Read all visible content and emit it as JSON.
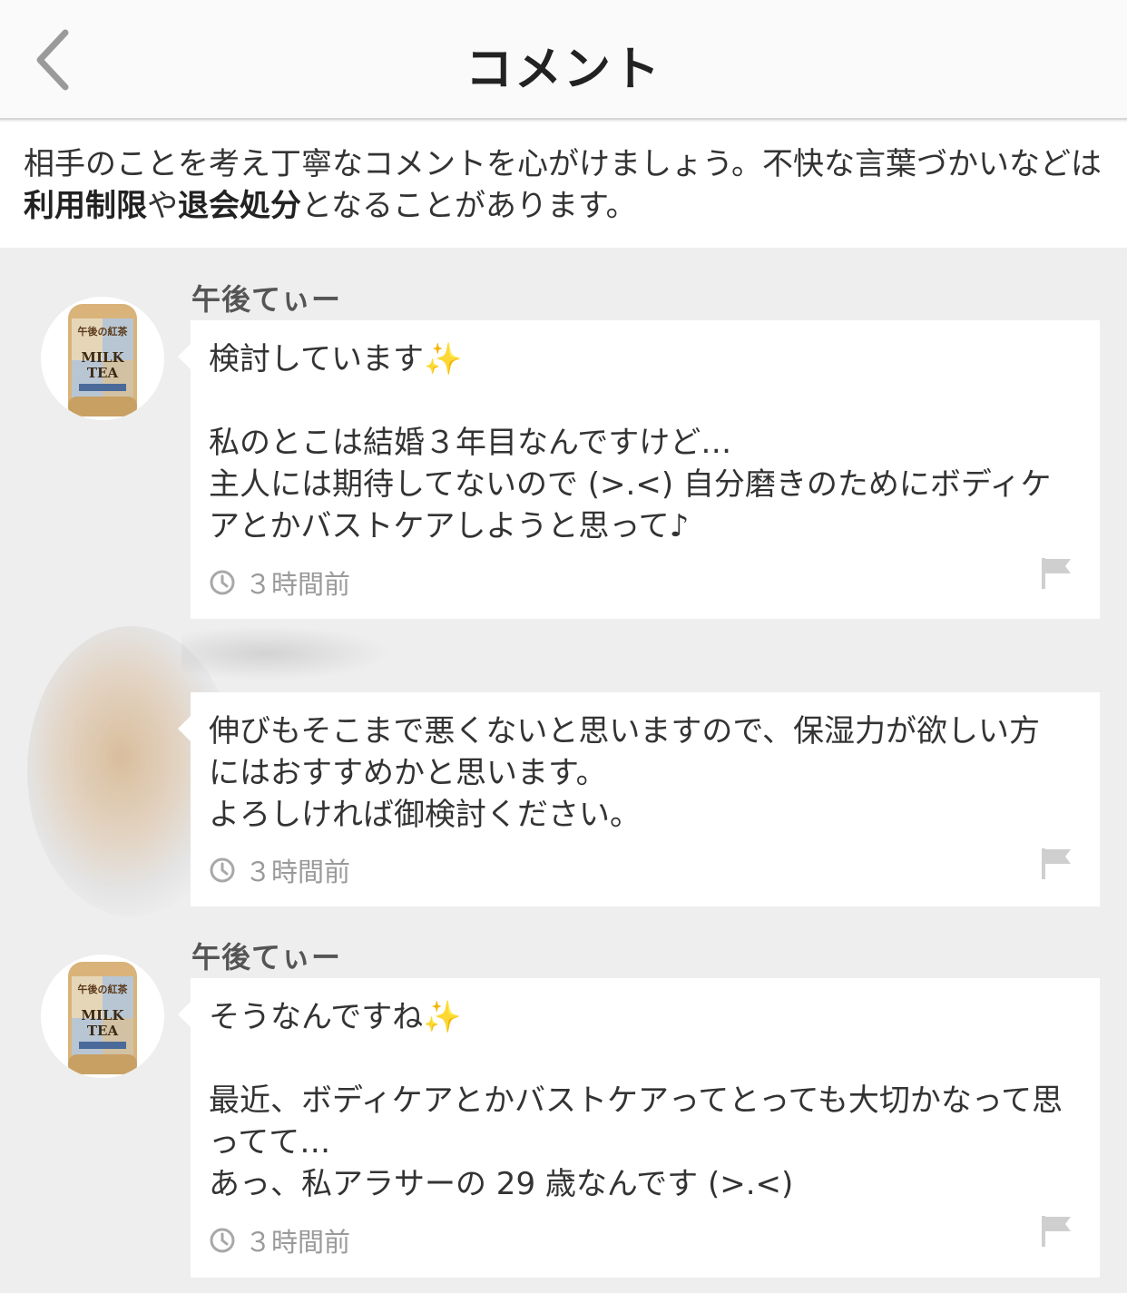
{
  "header": {
    "title": "コメント",
    "back_icon": "chevron-left-icon"
  },
  "notice": {
    "part1": "相手のことを考え丁寧なコメントを心がけましょう。不快な言葉づかいなどは",
    "bold1": "利用制限",
    "part2": "や",
    "bold2": "退会処分",
    "part3": "となることがあります。"
  },
  "comments": [
    {
      "author": "午後てぃー",
      "text": "検討しています✨\n\n私のとこは結婚３年目なんですけど…\n主人には期待してないので (>.<) 自分磨きのためにボディケアとかバストケアしようと思って♪",
      "time": "３時間前",
      "avatar_text": {
        "brand": "午後の紅茶",
        "line1": "MILK",
        "line2": "TEA"
      }
    },
    {
      "author": "",
      "text": "伸びもそこまで悪くないと思いますので、保湿力が欲しい方にはおすすめかと思います。\nよろしければ御検討ください。",
      "time": "３時間前"
    },
    {
      "author": "午後てぃー",
      "text": "そうなんですね✨\n\n最近、ボディケアとかバストケアってとっても大切かなって思ってて…\nあっ、私アラサーの 29 歳なんです (>.<)",
      "time": "３時間前",
      "avatar_text": {
        "brand": "午後の紅茶",
        "line1": "MILK",
        "line2": "TEA"
      }
    }
  ],
  "colors": {
    "background": "#eeeeee",
    "card": "#ffffff",
    "muted": "#9a9a9a"
  }
}
